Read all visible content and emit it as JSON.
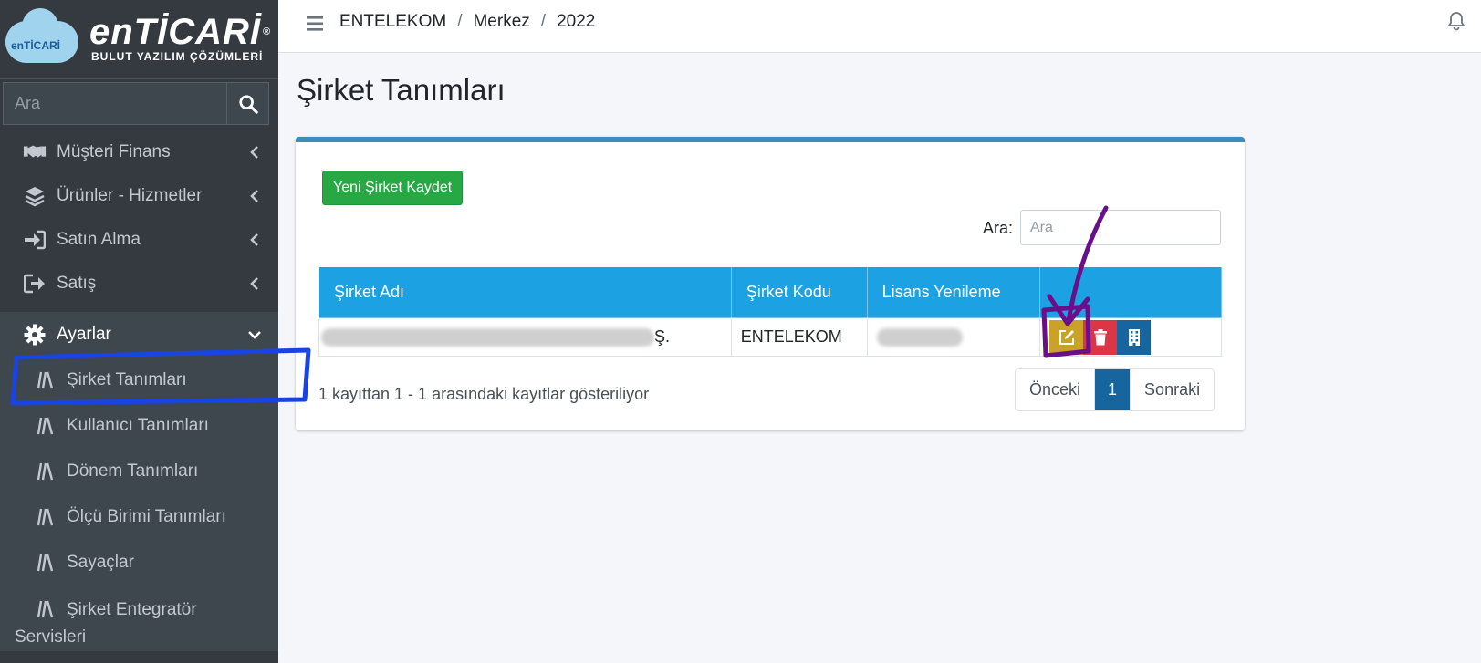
{
  "brand": {
    "logo_small": "enTİCARİ",
    "title": "enTİCARİ",
    "registered": "®",
    "subtitle": "BULUT YAZILIM ÇÖZÜMLERİ"
  },
  "sidebar": {
    "search_placeholder": "Ara",
    "items": [
      {
        "label": "Müşteri Finans",
        "icon": "handshake-icon"
      },
      {
        "label": "Ürünler - Hizmetler",
        "icon": "layers-icon"
      },
      {
        "label": "Satın Alma",
        "icon": "sign-in-icon"
      },
      {
        "label": "Satış",
        "icon": "sign-out-icon"
      },
      {
        "label": "Ayarlar",
        "icon": "gear-icon"
      }
    ],
    "sub_items": [
      {
        "label": "Şirket Tanımları"
      },
      {
        "label": "Kullanıcı Tanımları"
      },
      {
        "label": "Dönem Tanımları"
      },
      {
        "label": "Ölçü Birimi Tanımları"
      },
      {
        "label": "Sayaçlar"
      },
      {
        "label": "Şirket Entegratör Servisleri"
      }
    ]
  },
  "topbar": {
    "breadcrumb": [
      "ENTELEKOM",
      "Merkez",
      "2022"
    ],
    "separator": "/"
  },
  "main": {
    "title": "Şirket Tanımları",
    "new_button": "Yeni Şirket Kaydet",
    "filter_label": "Ara:",
    "filter_placeholder": "Ara",
    "columns": [
      "Şirket Adı",
      "Şirket Kodu",
      "Lisans Yenileme",
      ""
    ],
    "rows": [
      {
        "name_suffix": "Ş.",
        "code": "ENTELEKOM",
        "license": ""
      }
    ],
    "info": "1 kayıttan 1 - 1 arasındaki kayıtlar gösteriliyor",
    "pager": {
      "prev": "Önceki",
      "current": "1",
      "next": "Sonraki"
    }
  },
  "colors": {
    "sidebar_bg": "#343a40",
    "table_header": "#1ca1e2",
    "accent_blue": "#3c8dbc",
    "btn_green": "#28a745",
    "edit": "#c9a227",
    "delete": "#dc3545",
    "building": "#17659f",
    "annot_blue": "#1844e6",
    "annot_purple": "#6a0f8a"
  }
}
